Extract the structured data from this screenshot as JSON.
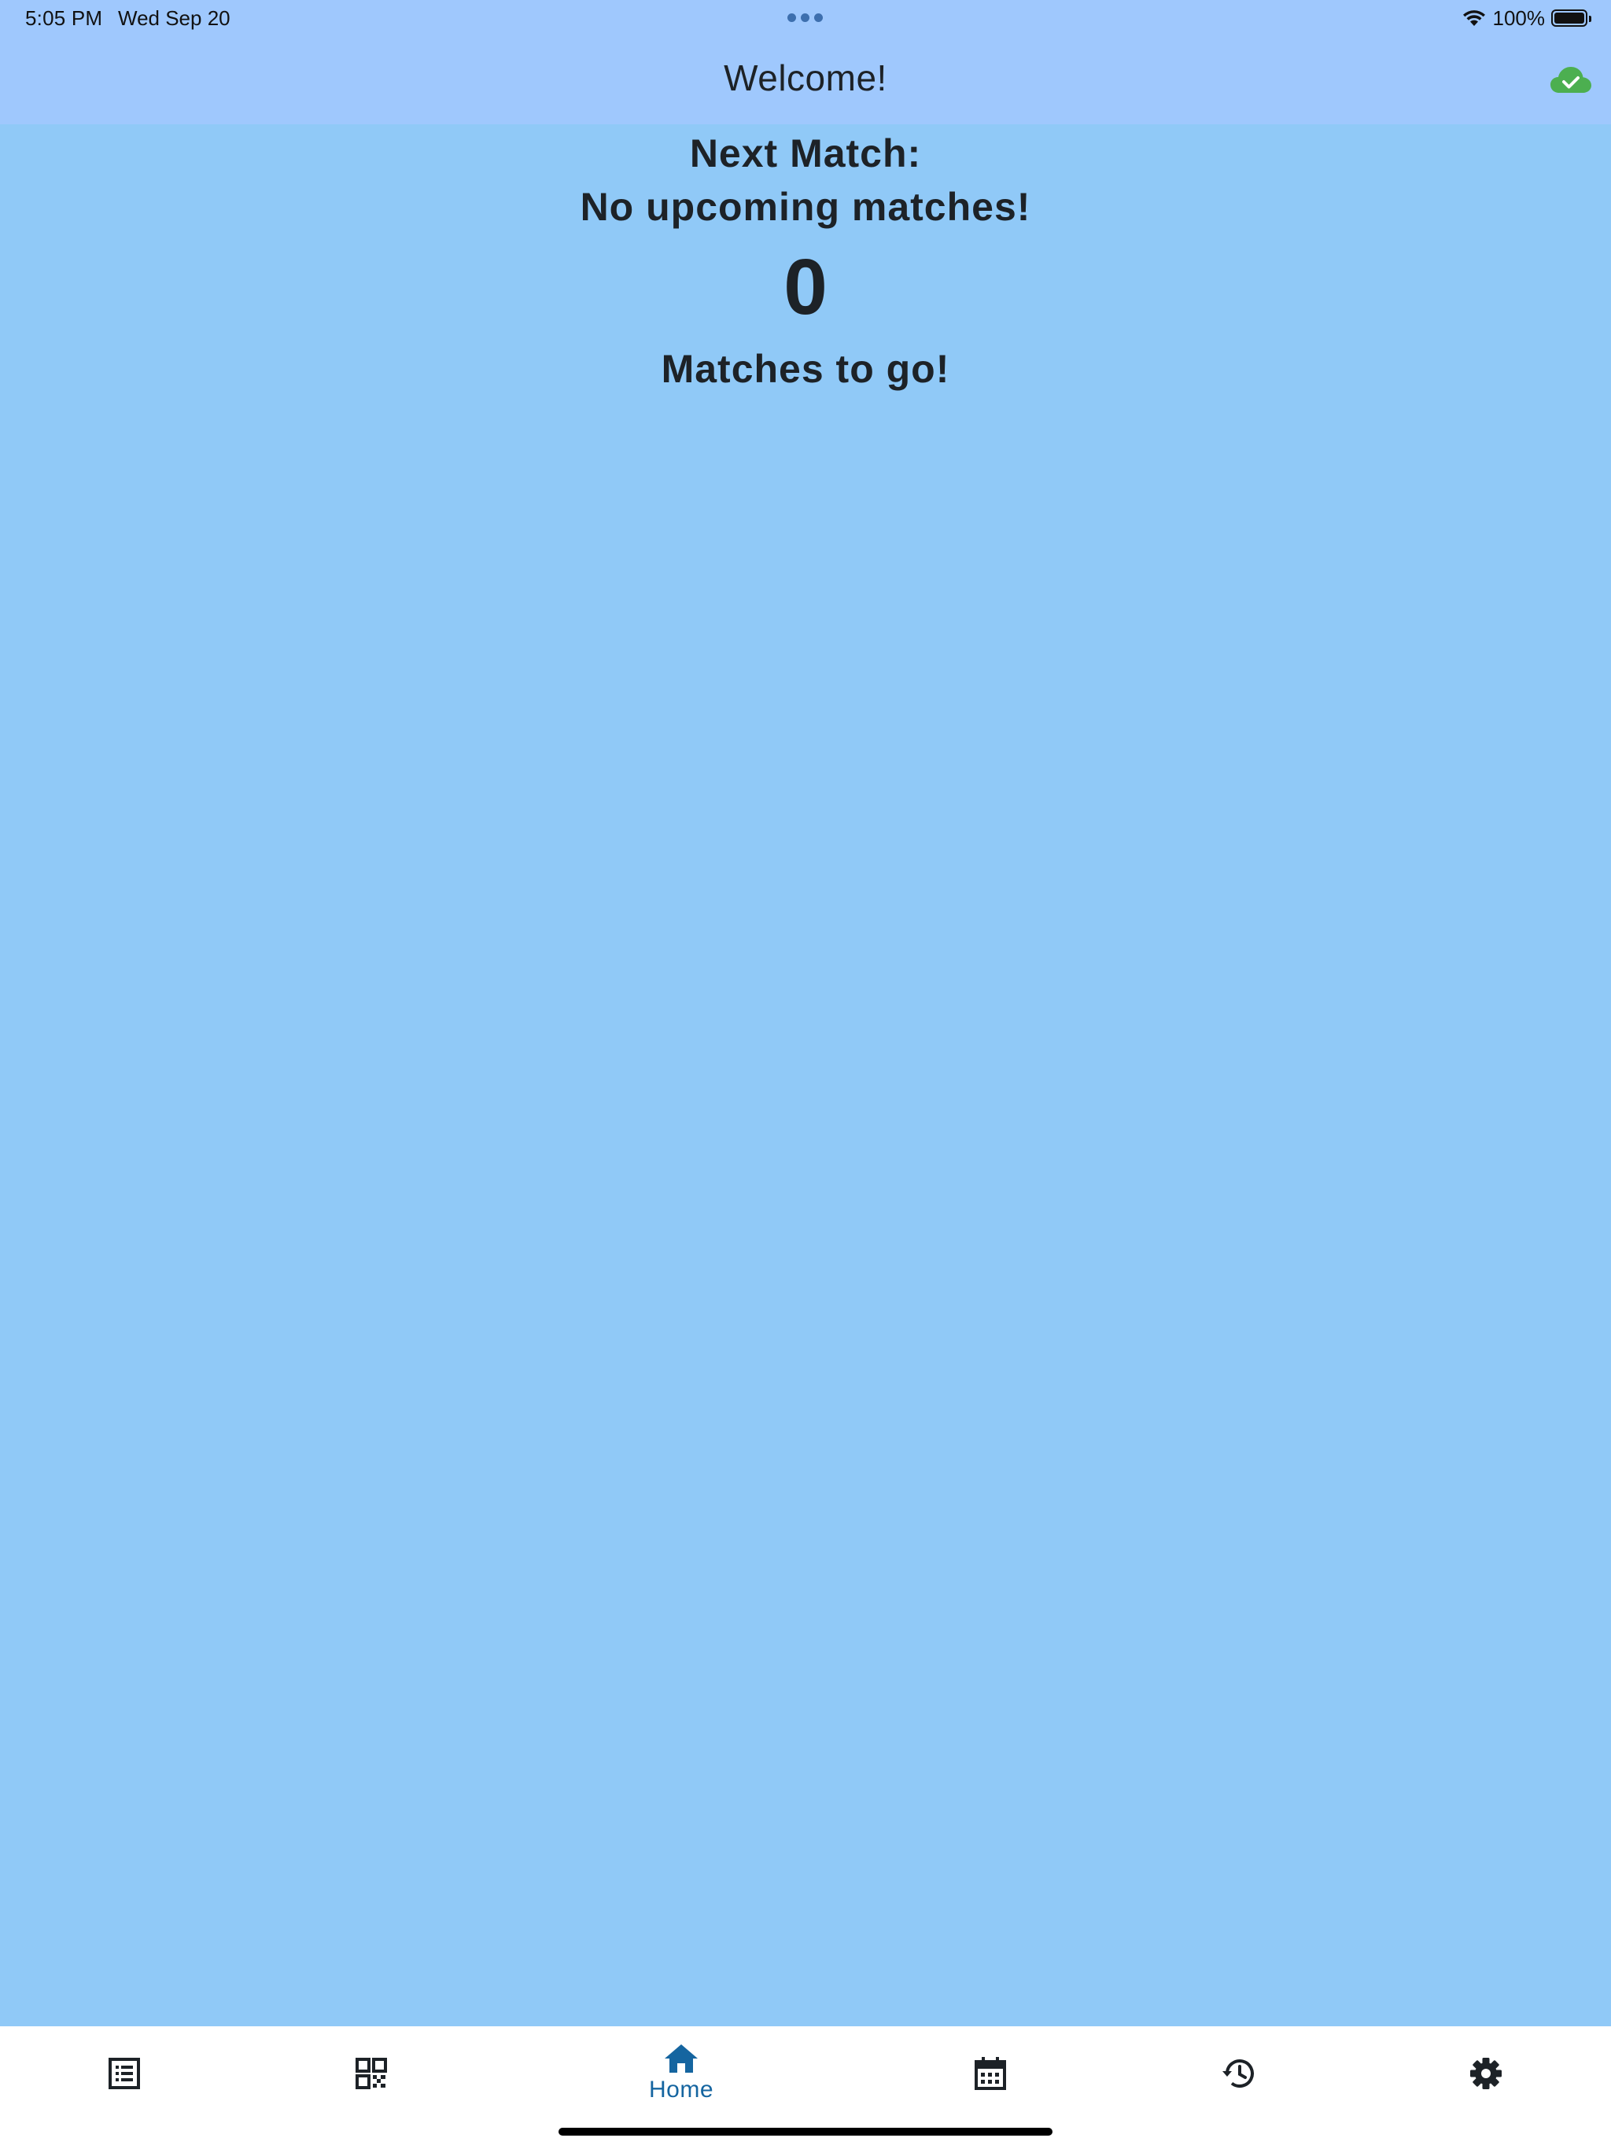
{
  "status_bar": {
    "time": "5:05 PM",
    "date": "Wed Sep 20",
    "battery": "100%"
  },
  "header": {
    "title": "Welcome!",
    "sync_icon": "cloud-check-icon",
    "sync_color": "#4caf50"
  },
  "main": {
    "next_match_label": "Next Match:",
    "next_match_value": "No upcoming matches!",
    "matches_count": "0",
    "matches_label": "Matches to go!"
  },
  "tabs": [
    {
      "icon": "list-icon",
      "label": ""
    },
    {
      "icon": "qr-code-icon",
      "label": ""
    },
    {
      "icon": "home-icon",
      "label": "Home",
      "active": true
    },
    {
      "icon": "calendar-icon",
      "label": ""
    },
    {
      "icon": "history-icon",
      "label": ""
    },
    {
      "icon": "settings-icon",
      "label": ""
    }
  ],
  "colors": {
    "header_bg": "#9fc8fd",
    "body_bg": "#90c9f7",
    "active_tab": "#1565a0",
    "text": "#1d2227"
  }
}
